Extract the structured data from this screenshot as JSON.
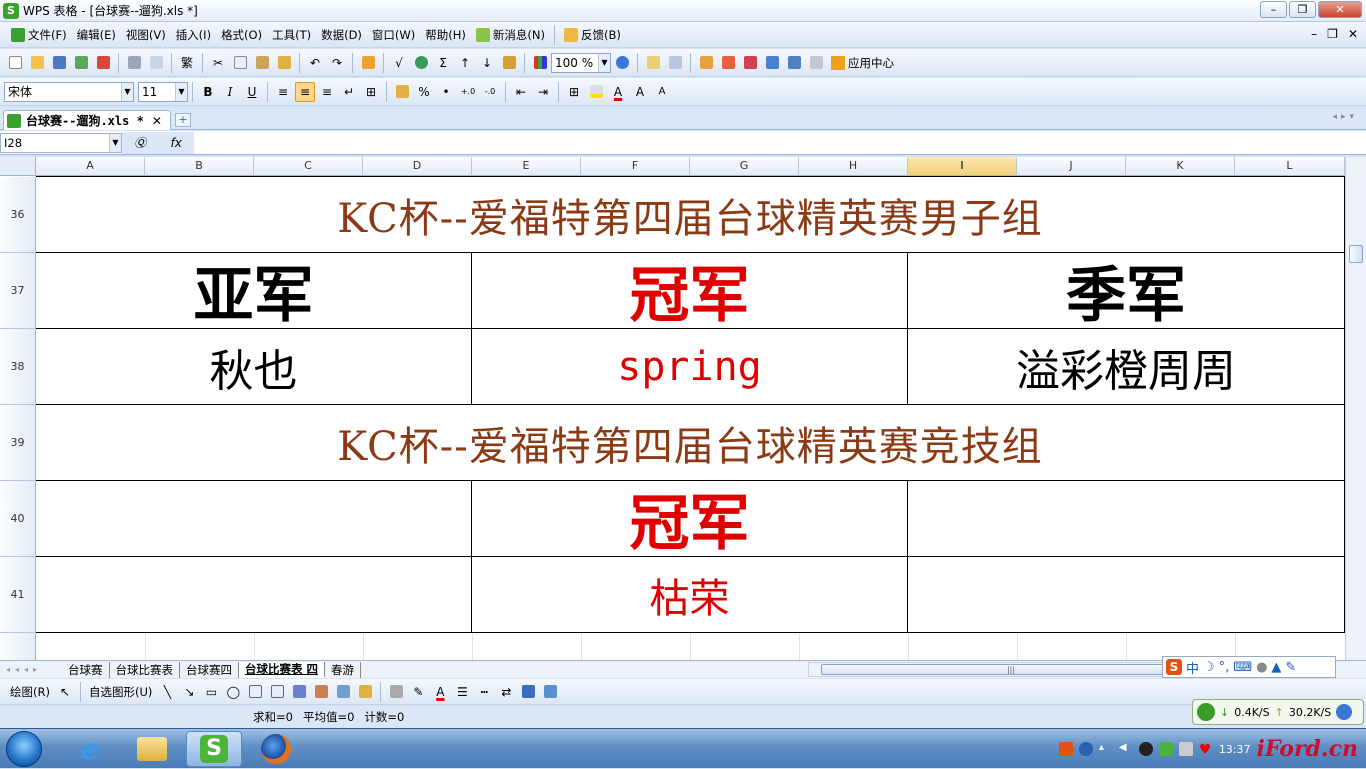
{
  "window": {
    "title": "WPS 表格 - [台球赛--遛狗.xls *]",
    "logo": "S"
  },
  "menu": [
    "文件(F)",
    "编辑(E)",
    "视图(V)",
    "插入(I)",
    "格式(O)",
    "工具(T)",
    "数据(D)",
    "窗口(W)",
    "帮助(H)",
    "新消息(N)",
    "反馈(B)"
  ],
  "toolbar": {
    "zoom": "100 %",
    "app_center": "应用中心"
  },
  "format": {
    "font": "宋体",
    "size": "11",
    "bold": "B",
    "italic": "I",
    "underline": "U",
    "percent": "%",
    "comma": "•",
    "font_up": "A",
    "font_down": "A"
  },
  "tab": {
    "doc_name": "台球赛--遛狗.xls *",
    "close": "✕",
    "add": "+"
  },
  "formula": {
    "cell_ref": "I28",
    "fx": "fx",
    "value": ""
  },
  "columns": [
    "A",
    "B",
    "C",
    "D",
    "E",
    "F",
    "G",
    "H",
    "I",
    "J",
    "K",
    "L"
  ],
  "selected_column": "I",
  "rows": [
    "36",
    "37",
    "38",
    "39",
    "40",
    "41"
  ],
  "sheet": {
    "r36_title": "KC杯--爱福特第四届台球精英赛男子组",
    "r37_left": "亚军",
    "r37_center": "冠军",
    "r37_right": "季军",
    "r38_left": "秋也",
    "r38_center": "spring",
    "r38_right": "溢彩橙周周",
    "r39_title": "KC杯--爱福特第四届台球精英赛竞技组",
    "r40_center": "冠军",
    "r41_center": "枯荣"
  },
  "sheet_tabs": [
    "台球赛",
    "台球比赛表",
    "台球赛四",
    "台球比赛表 四",
    "春游"
  ],
  "active_sheet": "台球比赛表 四",
  "drawbar": {
    "draw": "绘图(R)",
    "autoshape": "自选图形(U)"
  },
  "status": {
    "sum": "求和=0",
    "avg": "平均值=0",
    "count": "计数=0"
  },
  "ime": {
    "logo": "S",
    "mode": "中"
  },
  "net": {
    "down": "0.4K/S",
    "up": "30.2K/S"
  },
  "tray": {
    "time": "13:37"
  },
  "watermark": "iFord.cn",
  "colors": {
    "title_brown": "#8b3a16",
    "red": "#e00000",
    "select_orange": "#f4cf78"
  }
}
